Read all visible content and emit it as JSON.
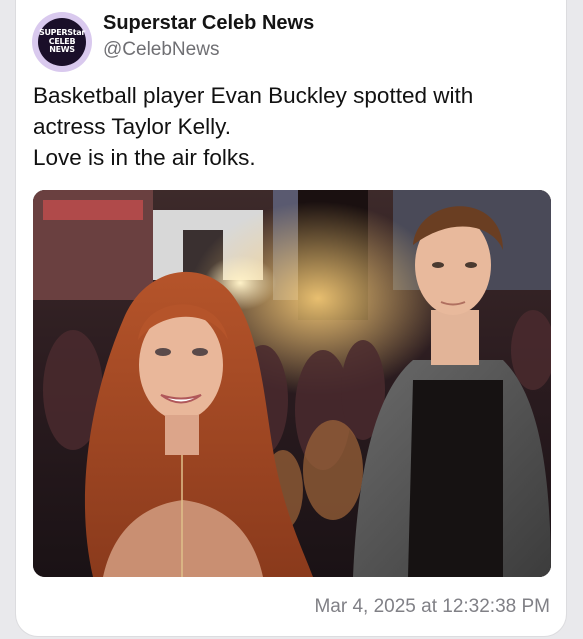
{
  "account": {
    "avatar_lines": [
      "SUPERStar",
      "CELEB",
      "NEWS"
    ],
    "display_name": "Superstar Celeb News",
    "handle": "@CelebNews"
  },
  "post": {
    "text_lines": [
      "Basketball player Evan Buckley spotted with",
      "actress Taylor Kelly.",
      "Love is in the air folks."
    ],
    "media_description_icon": "photo",
    "timestamp": "Mar 4, 2025 at 12:32:38 PM"
  },
  "colors": {
    "background": "#e9e9ec",
    "card": "#ffffff",
    "text_primary": "#111111",
    "text_secondary": "#6f6f73",
    "avatar_ring": "#d9c9ee",
    "avatar_fill": "#1a0f29"
  }
}
